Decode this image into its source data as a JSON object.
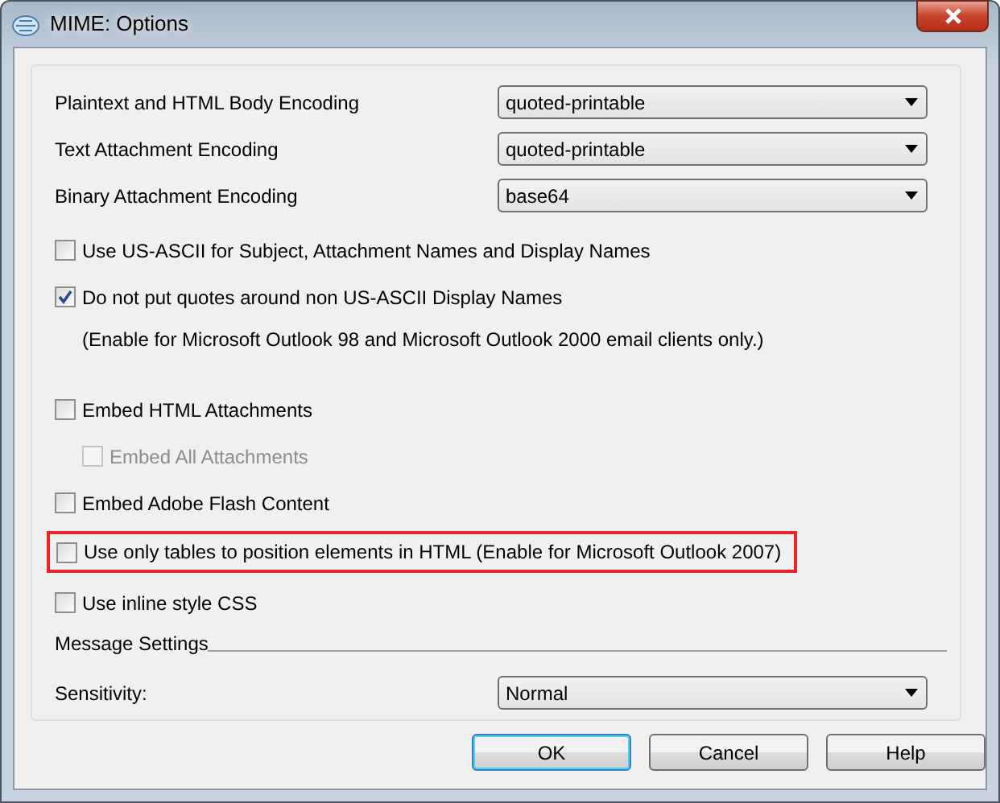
{
  "window": {
    "title": "MIME: Options"
  },
  "encodings": [
    {
      "label": "Plaintext and HTML Body Encoding",
      "value": "quoted-printable"
    },
    {
      "label": "Text Attachment Encoding",
      "value": "quoted-printable"
    },
    {
      "label": "Binary Attachment Encoding",
      "value": "base64"
    }
  ],
  "options": [
    {
      "kind": "checkbox",
      "label": "Use US-ASCII for Subject, Attachment Names and Display Names",
      "checked": false,
      "disabled": false,
      "highlighted": false
    },
    {
      "kind": "checkbox",
      "label": "Do not put quotes around non US-ASCII Display Names",
      "checked": true,
      "disabled": false,
      "highlighted": false
    },
    {
      "kind": "note",
      "label": "(Enable for Microsoft Outlook 98 and Microsoft Outlook 2000 email clients only.)"
    },
    {
      "kind": "checkbox",
      "label": "Embed HTML Attachments",
      "checked": false,
      "disabled": false,
      "highlighted": false,
      "children": [
        {
          "kind": "checkbox",
          "label": "Embed All Attachments",
          "checked": false,
          "disabled": true,
          "highlighted": false
        }
      ]
    },
    {
      "kind": "checkbox",
      "label": "Embed Adobe Flash Content",
      "checked": false,
      "disabled": false,
      "highlighted": false
    },
    {
      "kind": "checkbox",
      "label": "Use only tables to position elements in HTML (Enable for Microsoft Outlook 2007)",
      "checked": false,
      "disabled": false,
      "highlighted": true
    },
    {
      "kind": "checkbox",
      "label": "Use inline style CSS",
      "checked": false,
      "disabled": false,
      "highlighted": false
    }
  ],
  "message_settings": {
    "heading": "Message Settings",
    "sensitivity": {
      "label": "Sensitivity:",
      "value": "Normal"
    }
  },
  "buttons": [
    {
      "label": "OK",
      "default": true
    },
    {
      "label": "Cancel",
      "default": false
    },
    {
      "label": "Help",
      "default": false
    }
  ]
}
